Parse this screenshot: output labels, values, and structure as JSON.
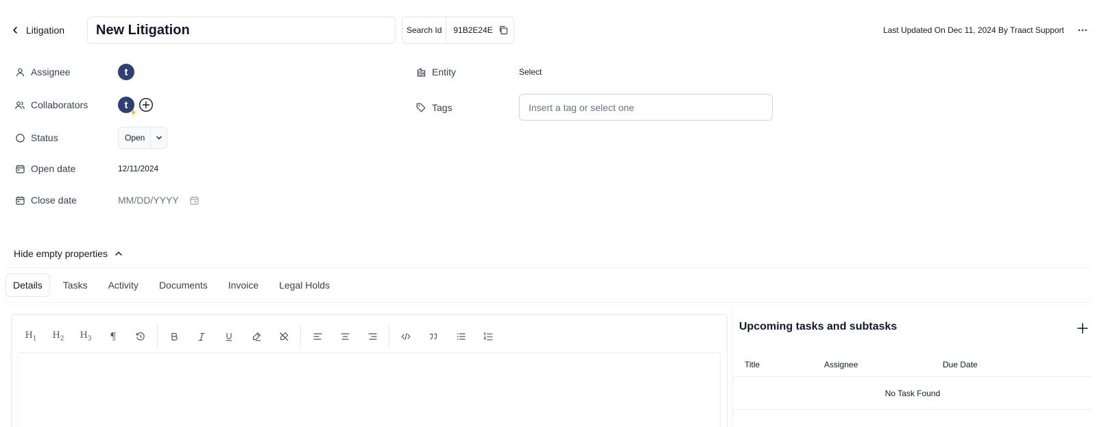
{
  "header": {
    "back_label": "Litigation",
    "title_value": "New Litigation",
    "search_id_label": "Search Id",
    "search_id_value": "91B2E24E",
    "last_updated": "Last Updated On Dec 11, 2024 By Traact Support"
  },
  "properties": {
    "assignee": {
      "label": "Assignee",
      "avatar_letter": "t"
    },
    "collaborators": {
      "label": "Collaborators",
      "avatar_letter": "t"
    },
    "status": {
      "label": "Status",
      "value": "Open"
    },
    "open_date": {
      "label": "Open date",
      "value": "12/11/2024"
    },
    "close_date": {
      "label": "Close date",
      "placeholder": "MM/DD/YYYY"
    },
    "entity": {
      "label": "Entity",
      "value": "Select"
    },
    "tags": {
      "label": "Tags",
      "placeholder": "Insert a tag or select one"
    },
    "hide_empty_label": "Hide empty properties"
  },
  "tabs": [
    {
      "label": "Details",
      "active": true
    },
    {
      "label": "Tasks"
    },
    {
      "label": "Activity"
    },
    {
      "label": "Documents"
    },
    {
      "label": "Invoice"
    },
    {
      "label": "Legal Holds"
    }
  ],
  "editor": {
    "toolbar_icons": [
      "heading-1-icon",
      "heading-2-icon",
      "heading-3-icon",
      "paragraph-icon",
      "clear-format-icon",
      "bold-icon",
      "italic-icon",
      "underline-icon",
      "highlight-icon",
      "clear-highlight-icon",
      "align-left-icon",
      "align-center-icon",
      "align-right-icon",
      "code-icon",
      "quote-icon",
      "bullet-list-icon",
      "ordered-list-icon"
    ],
    "h1": "H",
    "h2": "H",
    "h3": "H",
    "h1_sub": "1",
    "h2_sub": "2",
    "h3_sub": "3",
    "paragraph": "¶"
  },
  "upcoming": {
    "title": "Upcoming tasks and subtasks",
    "columns": [
      "Title",
      "Assignee",
      "Due Date"
    ],
    "empty_text": "No Task Found"
  },
  "colors": {
    "avatar": "#2e3f73",
    "bolt": "#f5b82e",
    "border": "#e5e7eb",
    "text": "#111827"
  }
}
